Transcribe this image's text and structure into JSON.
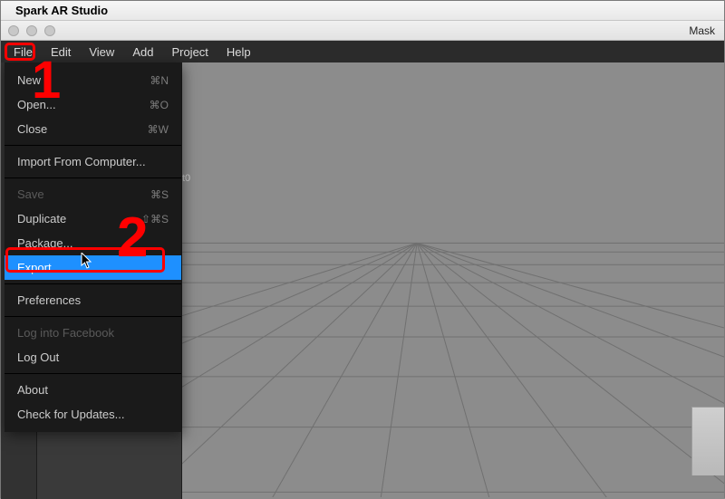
{
  "mac": {
    "app_name": "Spark AR Studio"
  },
  "window": {
    "document_title": "Mask"
  },
  "menubar": {
    "file": "File",
    "edit": "Edit",
    "view": "View",
    "add": "Add",
    "project": "Project",
    "help": "Help"
  },
  "file_menu": {
    "new": {
      "label": "New",
      "shortcut": "⌘N"
    },
    "open": {
      "label": "Open...",
      "shortcut": "⌘O"
    },
    "close": {
      "label": "Close",
      "shortcut": "⌘W"
    },
    "import": {
      "label": "Import From Computer..."
    },
    "save": {
      "label": "Save",
      "shortcut": "⌘S"
    },
    "duplicate": {
      "label": "Duplicate",
      "shortcut": "⇧⌘S"
    },
    "package": {
      "label": "Package..."
    },
    "export": {
      "label": "Export..."
    },
    "preferences": {
      "label": "Preferences"
    },
    "login": {
      "label": "Log into Facebook"
    },
    "logout": {
      "label": "Log Out"
    },
    "about": {
      "label": "About"
    },
    "updates": {
      "label": "Check for Updates..."
    }
  },
  "viewport": {
    "fragment_text": "t0"
  },
  "annotations": {
    "step1": "1",
    "step2": "2"
  }
}
